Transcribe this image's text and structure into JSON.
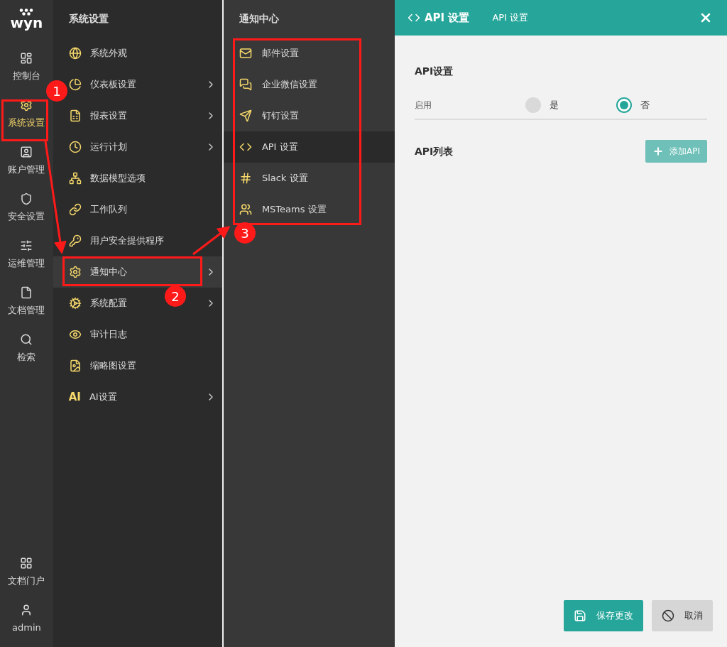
{
  "nav_rail": {
    "logo": "wyn",
    "items": [
      {
        "label": "控制台",
        "selected": false
      },
      {
        "label": "系统设置",
        "selected": true
      },
      {
        "label": "账户管理",
        "selected": false
      },
      {
        "label": "安全设置",
        "selected": false
      },
      {
        "label": "运维管理",
        "selected": false
      },
      {
        "label": "文档管理",
        "selected": false
      },
      {
        "label": "检索",
        "selected": false
      }
    ],
    "bottom_items": [
      {
        "label": "文档门户"
      },
      {
        "label": "admin"
      }
    ]
  },
  "settings_menu": {
    "title": "系统设置",
    "items": [
      {
        "label": "系统外观",
        "submenu": false,
        "selected": false
      },
      {
        "label": "仪表板设置",
        "submenu": true,
        "selected": false
      },
      {
        "label": "报表设置",
        "submenu": true,
        "selected": false
      },
      {
        "label": "运行计划",
        "submenu": true,
        "selected": false
      },
      {
        "label": "数据模型选项",
        "submenu": false,
        "selected": false
      },
      {
        "label": "工作队列",
        "submenu": false,
        "selected": false
      },
      {
        "label": "用户安全提供程序",
        "submenu": false,
        "selected": false
      },
      {
        "label": "通知中心",
        "submenu": true,
        "selected": true
      },
      {
        "label": "系统配置",
        "submenu": true,
        "selected": false
      },
      {
        "label": "审计日志",
        "submenu": false,
        "selected": false
      },
      {
        "label": "缩略图设置",
        "submenu": false,
        "selected": false
      },
      {
        "icon_text": "AI",
        "label": "AI设置",
        "submenu": true,
        "selected": false
      }
    ]
  },
  "notification_menu": {
    "title": "通知中心",
    "items": [
      {
        "label": "邮件设置",
        "selected": false
      },
      {
        "label": "企业微信设置",
        "selected": false
      },
      {
        "label": "钉钉设置",
        "selected": false
      },
      {
        "label": "API 设置",
        "selected": true
      },
      {
        "label": "Slack 设置",
        "selected": false
      },
      {
        "label": "MSTeams 设置",
        "selected": false
      }
    ]
  },
  "panel": {
    "title": "API 设置",
    "breadcrumb": "API 设置",
    "section_title": "API设置",
    "enable_label": "启用",
    "options": [
      {
        "label": "是",
        "selected": false
      },
      {
        "label": "否",
        "selected": true
      }
    ],
    "list_title": "API列表",
    "add_button": "添加API",
    "save_button": "保存更改",
    "cancel_button": "取消"
  },
  "annotations": [
    {
      "label": "1"
    },
    {
      "label": "2"
    },
    {
      "label": "3"
    }
  ]
}
